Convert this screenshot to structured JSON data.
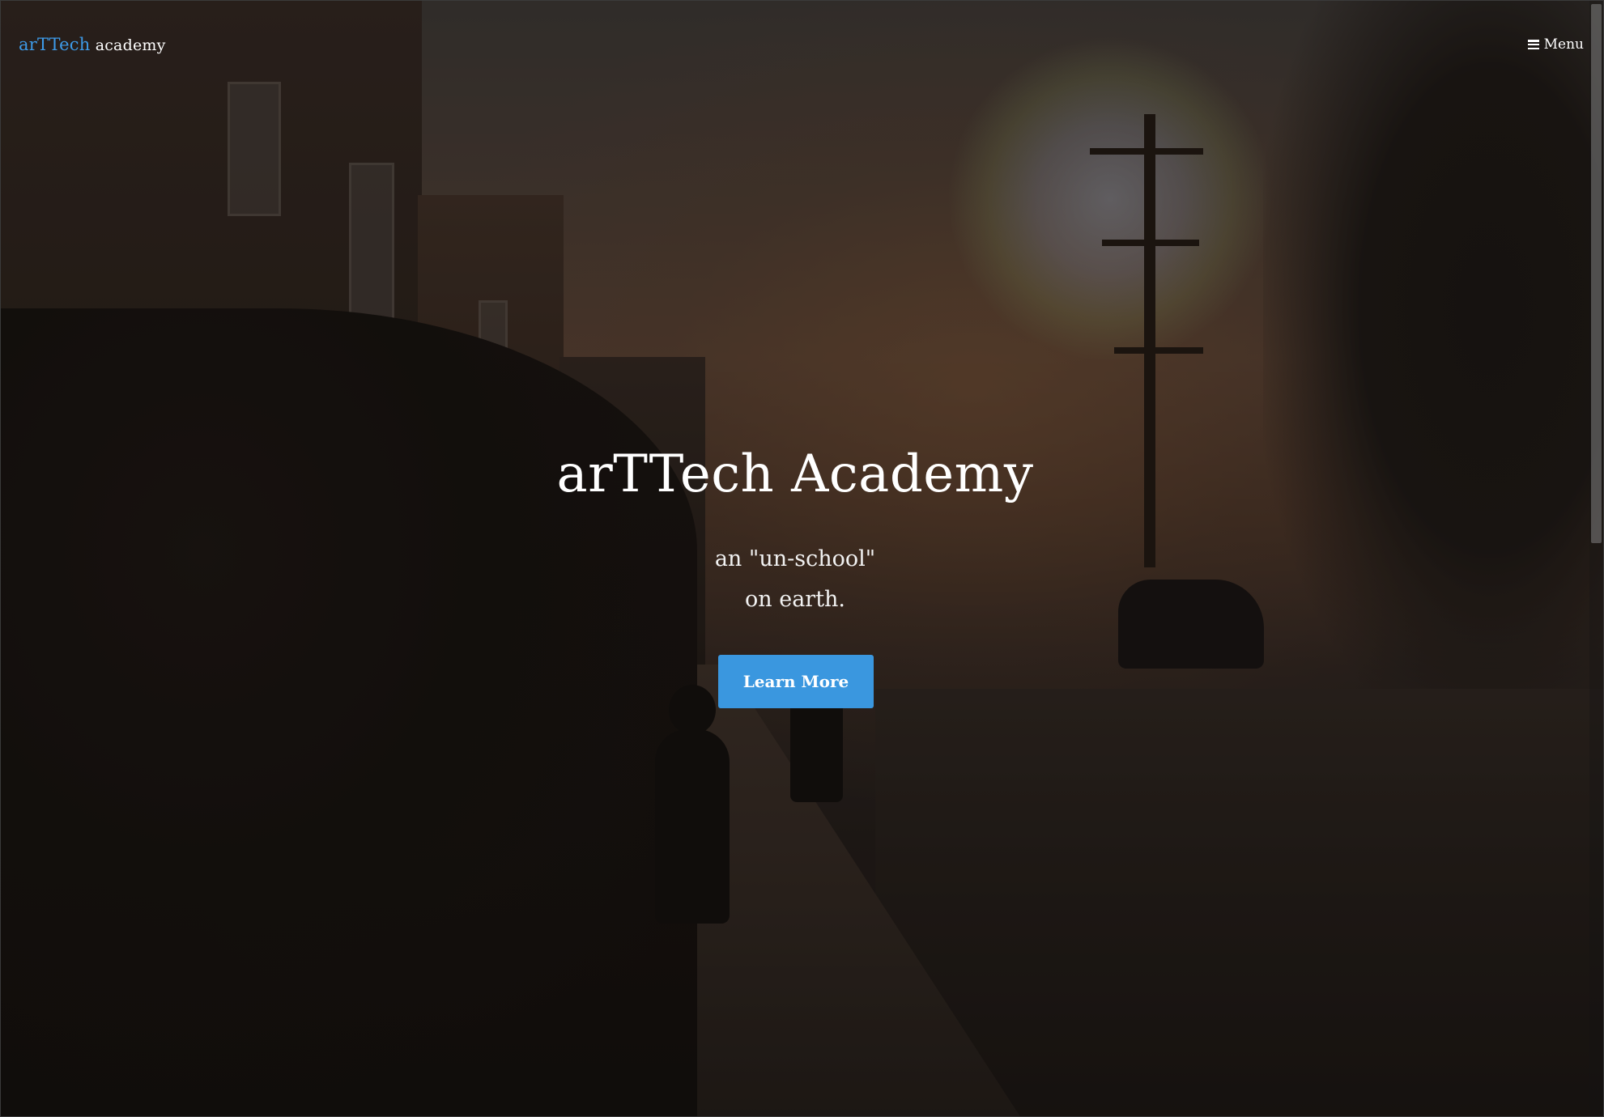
{
  "navbar": {
    "brand_accent": "arTTech",
    "brand_rest": " academy",
    "menu_label": "Menu",
    "menu_icon": "bars-icon"
  },
  "hero": {
    "title": "arTTech Academy",
    "subtitle_line1": "an \"un-school\"",
    "subtitle_line2": "on earth.",
    "cta_label": "Learn More"
  },
  "colors": {
    "accent": "#3a97df",
    "brand_accent": "#3d9ae8",
    "text": "#ffffff"
  }
}
